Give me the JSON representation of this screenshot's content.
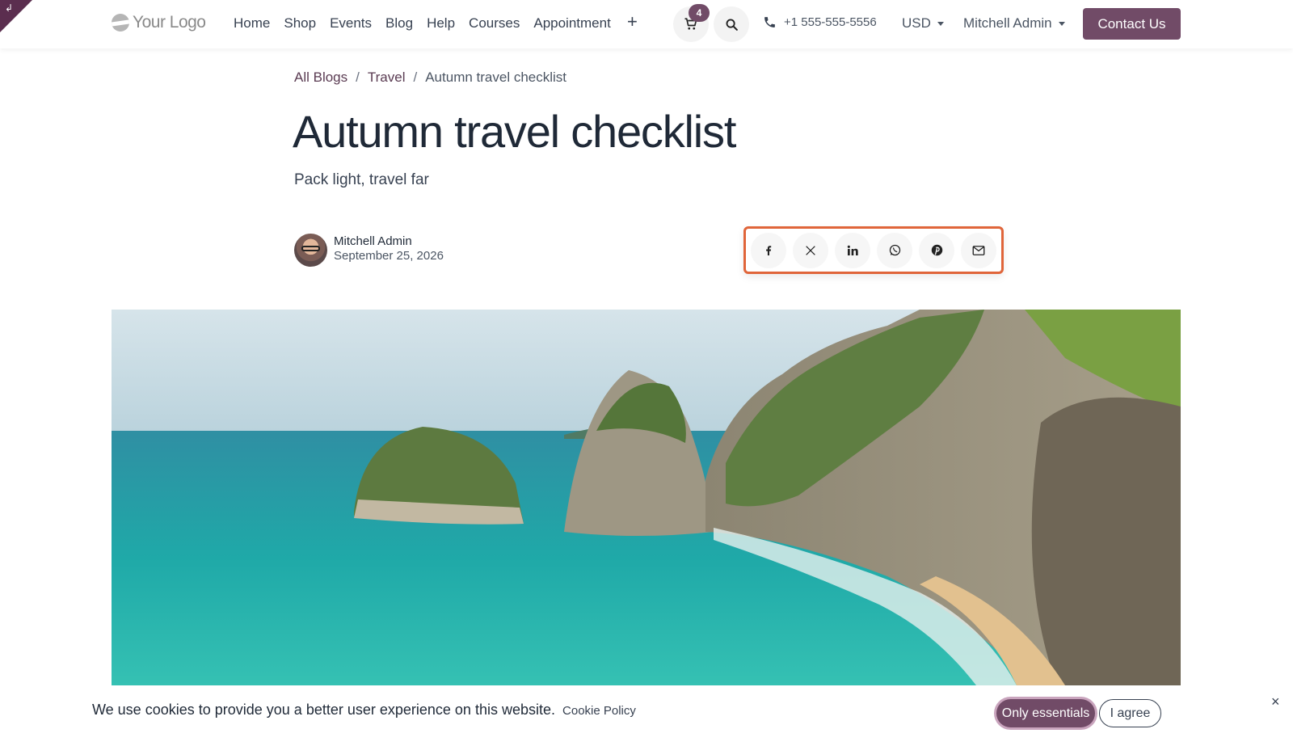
{
  "header": {
    "logo_text": "Your Logo",
    "nav": [
      "Home",
      "Shop",
      "Events",
      "Blog",
      "Help",
      "Courses",
      "Appointment"
    ],
    "add_icon": "plus-icon",
    "cart_count": "4",
    "phone": "+1 555-555-5556",
    "currency": "USD",
    "user": "Mitchell Admin",
    "contact_label": "Contact Us",
    "accent_color": "#714b67"
  },
  "breadcrumb": {
    "items": [
      "All Blogs",
      "Travel",
      "Autumn travel checklist"
    ],
    "separator": "/"
  },
  "post": {
    "title": "Autumn travel checklist",
    "subtitle": "Pack light, travel far",
    "author": "Mitchell Admin",
    "date": "September 25, 2026",
    "share_icons": [
      "facebook-icon",
      "x-icon",
      "linkedin-icon",
      "whatsapp-icon",
      "pinterest-icon",
      "email-icon"
    ]
  },
  "cookie": {
    "message": "We use cookies to provide you a better user experience on this website.",
    "policy_link": "Cookie Policy",
    "essentials_label": "Only essentials",
    "agree_label": "I agree",
    "close_glyph": "×"
  }
}
